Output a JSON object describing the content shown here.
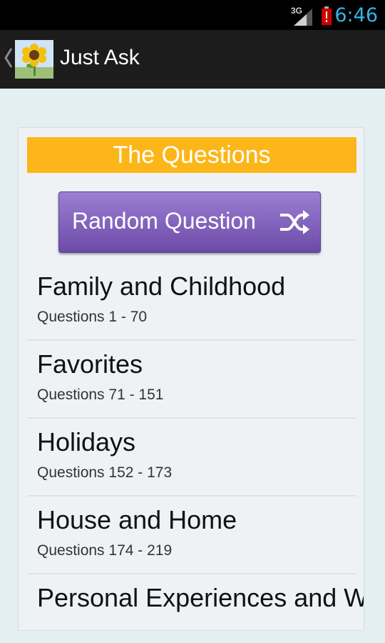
{
  "status_bar": {
    "network_type": "3G",
    "time": "6:46",
    "signal_icon": "signal-icon",
    "battery_icon": "battery-alert-icon"
  },
  "action_bar": {
    "title": "Just Ask",
    "up_icon": "chevron-left-icon",
    "app_icon": "sunflower-icon"
  },
  "content": {
    "section_title": "The Questions",
    "random_button_label": "Random Question",
    "random_button_icon": "shuffle-icon",
    "topics": [
      {
        "name": "Family and Childhood",
        "range": "Questions 1 - 70"
      },
      {
        "name": "Favorites",
        "range": "Questions 71 - 151"
      },
      {
        "name": "Holidays",
        "range": "Questions 152 - 173"
      },
      {
        "name": "House and Home",
        "range": "Questions 174 - 219"
      },
      {
        "name": "Personal Experiences and Well Being",
        "range": ""
      }
    ]
  },
  "colors": {
    "banner": "#fdb619",
    "button_top": "#9b7fd3",
    "button_bottom": "#6c4ba8",
    "clock": "#33b5e5",
    "background": "#e3eff0"
  }
}
